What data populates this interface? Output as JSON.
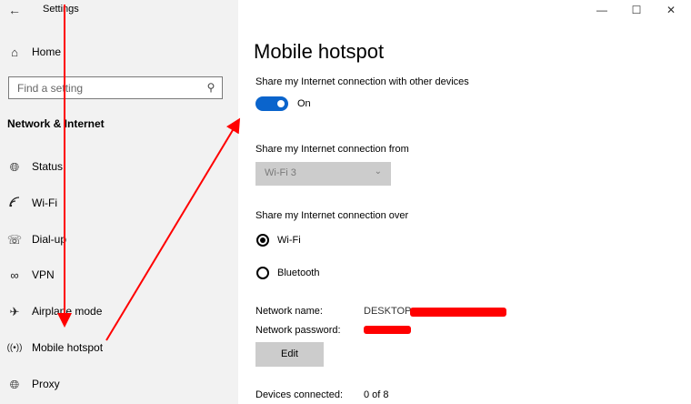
{
  "window": {
    "title": "Settings",
    "minimize_glyph": "—",
    "maximize_glyph": "☐",
    "close_glyph": "✕"
  },
  "sidebar": {
    "home_label": "Home",
    "search_placeholder": "Find a setting",
    "section_heading": "Network & Internet",
    "items": [
      {
        "label": "Status",
        "icon": "globe-icon"
      },
      {
        "label": "Wi-Fi",
        "icon": "wifi-icon"
      },
      {
        "label": "Dial-up",
        "icon": "dialup-icon"
      },
      {
        "label": "VPN",
        "icon": "vpn-icon"
      },
      {
        "label": "Airplane mode",
        "icon": "airplane-icon"
      },
      {
        "label": "Mobile hotspot",
        "icon": "hotspot-icon"
      },
      {
        "label": "Proxy",
        "icon": "globe-icon"
      }
    ]
  },
  "main": {
    "title": "Mobile hotspot",
    "share_label": "Share my Internet connection with other devices",
    "toggle_state": "On",
    "share_from_label": "Share my Internet connection from",
    "share_from_value": "Wi-Fi 3",
    "share_over_label": "Share my Internet connection over",
    "options": [
      {
        "label": "Wi-Fi",
        "selected": true
      },
      {
        "label": "Bluetooth",
        "selected": false
      }
    ],
    "network_name_label": "Network name:",
    "network_name_value": "DESKTOP-",
    "network_password_label": "Network password:",
    "edit_button": "Edit",
    "devices_connected_label": "Devices connected:",
    "devices_connected_value": "0 of 8"
  },
  "colors": {
    "accent": "#0a64cc",
    "annotation_red": "#ff0000",
    "sidebar_bg": "#f2f2f2",
    "disabled_control": "#cccccc"
  }
}
